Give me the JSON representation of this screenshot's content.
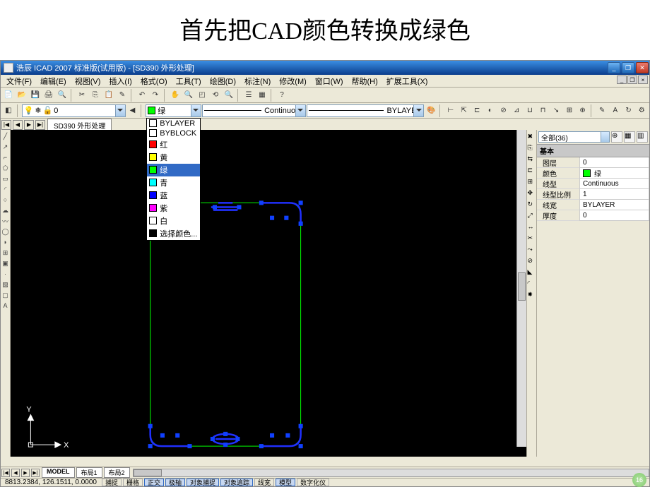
{
  "slide": {
    "title": "首先把CAD颜色转换成绿色",
    "number": "16"
  },
  "titlebar": {
    "text": "浩辰 ICAD 2007 标准版(试用版) - [SD390 外形处理]"
  },
  "menu": {
    "items": [
      "文件(F)",
      "编辑(E)",
      "视图(V)",
      "插入(I)",
      "格式(O)",
      "工具(T)",
      "绘图(D)",
      "标注(N)",
      "修改(M)",
      "窗口(W)",
      "帮助(H)",
      "扩展工具(X)"
    ]
  },
  "layer_dd": {
    "current": "0"
  },
  "color_dd": {
    "current": "绿",
    "options": [
      {
        "label": "BYLAYER",
        "color": "#ffffff",
        "border": "#000"
      },
      {
        "label": "BYBLOCK",
        "color": "#ffffff",
        "border": "#000"
      },
      {
        "label": "红",
        "color": "#ff0000"
      },
      {
        "label": "黄",
        "color": "#ffff00"
      },
      {
        "label": "绿",
        "color": "#00ff00",
        "selected": true
      },
      {
        "label": "青",
        "color": "#00ffff"
      },
      {
        "label": "蓝",
        "color": "#0000ff"
      },
      {
        "label": "紫",
        "color": "#ff00ff"
      },
      {
        "label": "白",
        "color": "#ffffff"
      },
      {
        "label": "选择颜色...",
        "color": "#000000"
      }
    ]
  },
  "linetype_dd": {
    "current": "Continuous"
  },
  "lineweight_dd": {
    "current": "BYLAYER"
  },
  "doc_tab": {
    "label": "SD390 外形处理"
  },
  "model_tabs": {
    "tabs": [
      "MODEL",
      "布局1",
      "布局2"
    ],
    "active": 0
  },
  "properties": {
    "selector": "全部(36)",
    "category": "基本",
    "rows": [
      {
        "k": "图层",
        "v": "0"
      },
      {
        "k": "颜色",
        "v": "绿",
        "swatch": "#00ff00"
      },
      {
        "k": "线型",
        "v": "Continuous"
      },
      {
        "k": "线型比例",
        "v": "1"
      },
      {
        "k": "线宽",
        "v": "BYLAYER"
      },
      {
        "k": "厚度",
        "v": "0"
      }
    ]
  },
  "statusbar": {
    "coord": "8813.2384, 126.1511, 0.0000",
    "buttons": [
      {
        "label": "捕捉",
        "on": false
      },
      {
        "label": "栅格",
        "on": false
      },
      {
        "label": "正交",
        "on": true
      },
      {
        "label": "极轴",
        "on": true
      },
      {
        "label": "对象捕捉",
        "on": true
      },
      {
        "label": "对象追踪",
        "on": true
      },
      {
        "label": "线宽",
        "on": false
      },
      {
        "label": "模型",
        "on": true
      },
      {
        "label": "数字化仪",
        "on": false
      }
    ]
  },
  "ucs": {
    "x_label": "X",
    "y_label": "Y"
  }
}
